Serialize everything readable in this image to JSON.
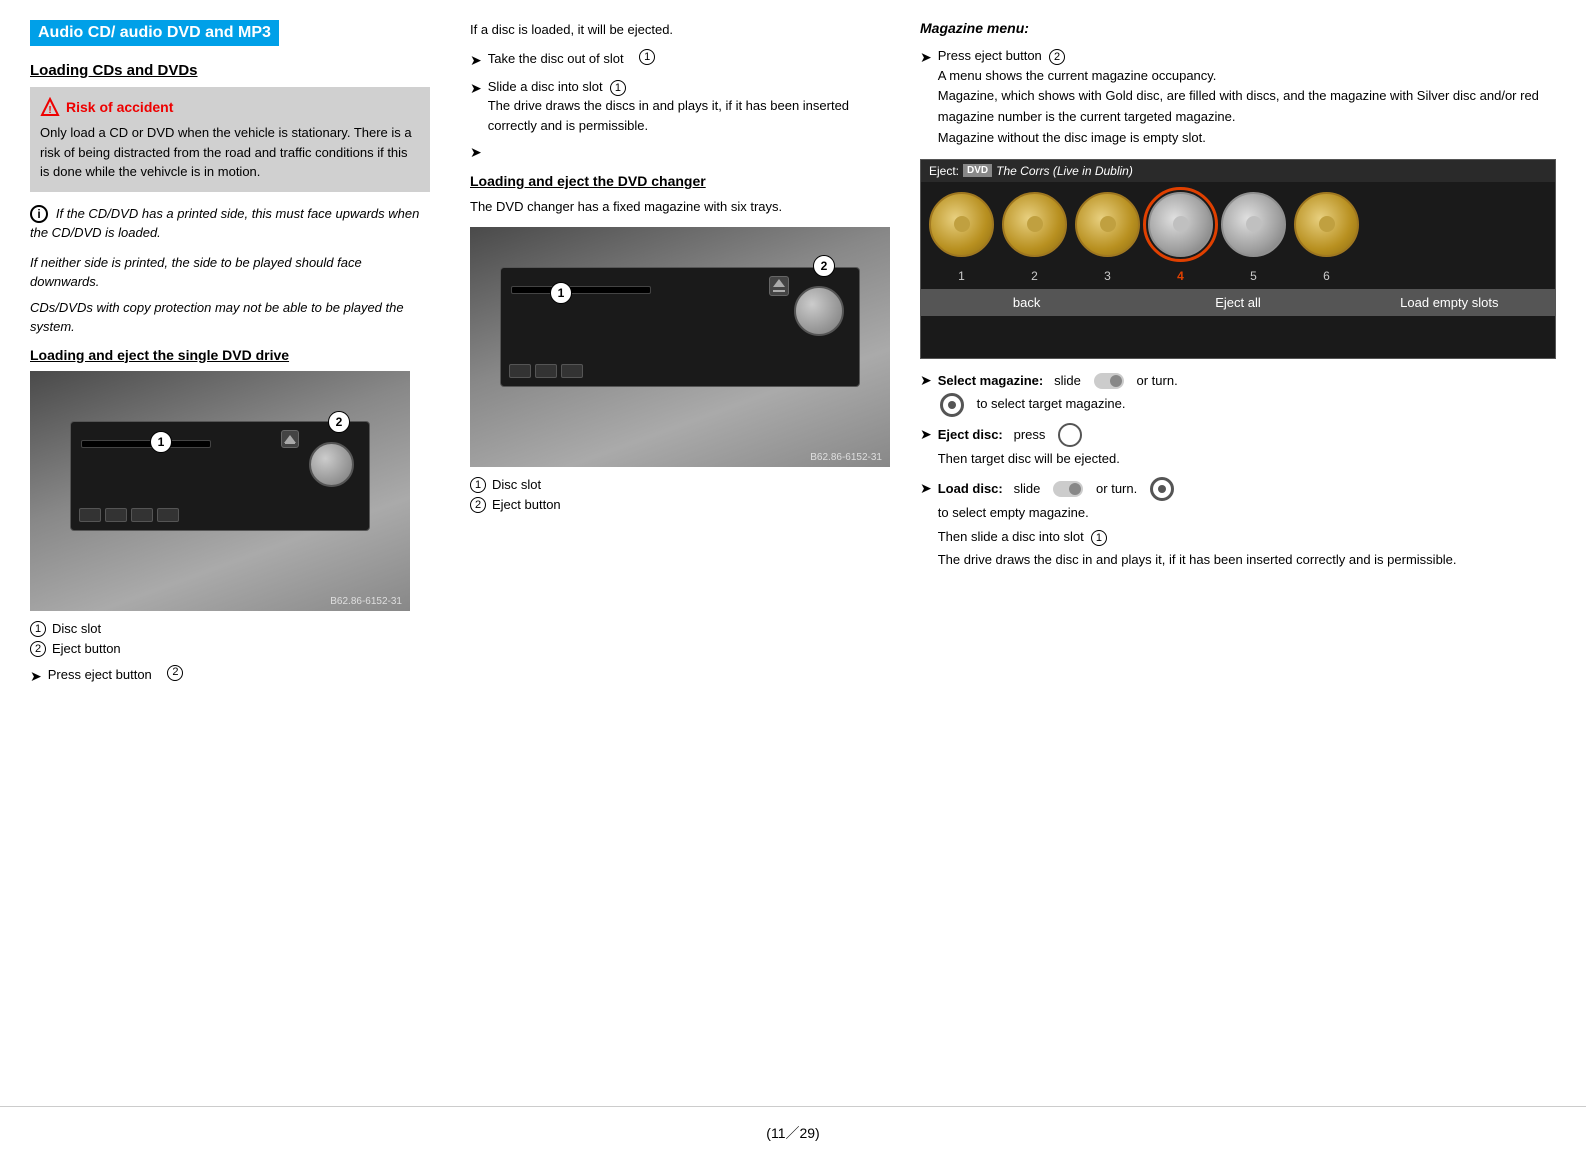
{
  "page": {
    "title": "Audio CD/ audio DVD and MP3",
    "footer": "(11／29)"
  },
  "left_column": {
    "section1_heading": "Loading CDs and DVDs",
    "warning_title": "Risk of accident",
    "warning_text": "Only load a CD or DVD when the vehicle is stationary. There is a risk of being distracted from the road and traffic conditions if this is done while the vehivcle is in motion.",
    "info_text1": "If the CD/DVD has a printed side, this must face upwards when the CD/DVD is loaded.",
    "info_text2": "If neither side is printed, the side to be played should face downwards.",
    "info_text3": "CDs/DVDs with copy protection may not be able to be played the system.",
    "section2_heading": "Loading and eject the single DVD drive",
    "caption1": "Disc slot",
    "caption2": "Eject button",
    "press_eject": "Press eject button",
    "img_stamp": "B62.86-6152-31"
  },
  "middle_column": {
    "intro_text": "If a disc is loaded, it will be ejected.",
    "bullet1": "Take the disc out of slot",
    "bullet2": "Slide a disc into slot",
    "bullet3_text": "The drive draws the discs in and plays it, if it has been inserted correctly and is permissible.",
    "section_heading": "Loading and eject the DVD changer",
    "section_text": "The DVD changer has a fixed magazine with six trays.",
    "caption1": "Disc slot",
    "caption2": "Eject button",
    "img_stamp": "B62.86-6152-31"
  },
  "right_column": {
    "section_heading": "Magazine menu:",
    "bullet1": "Press eject button",
    "bullet1_detail1": "A menu shows the current magazine occupancy.",
    "bullet1_detail2": "Magazine, which shows with Gold disc, are filled with discs, and the magazine with Silver disc and/or red magazine number is the current targeted magazine.",
    "bullet1_detail3": "Magazine without the disc image is empty slot.",
    "mag_header": "Eject:",
    "mag_title": "The Corrs (Live in Dublin)",
    "mag_footer_back": "back",
    "mag_footer_eject": "Eject all",
    "mag_footer_load": "Load empty slots",
    "disc_numbers": [
      "1",
      "2",
      "3",
      "4",
      "5",
      "6"
    ],
    "disc_highlighted_index": 3,
    "select_mag_label": "Select magazine:",
    "select_mag_text": "slide",
    "select_mag_text2": "or turn.",
    "select_mag_text3": "to select target magazine.",
    "eject_disc_label": "Eject disc:",
    "eject_disc_text": "press",
    "eject_disc_text2": "Then target disc will be ejected.",
    "load_disc_label": "Load disc:",
    "load_disc_text": "slide",
    "load_disc_text2": "or turn.",
    "load_disc_text3": "to select empty magazine.",
    "load_disc_text4": "Then slide a disc into slot",
    "load_disc_text5": "The drive draws the disc in and plays it, if it has been inserted correctly and is permissible."
  }
}
